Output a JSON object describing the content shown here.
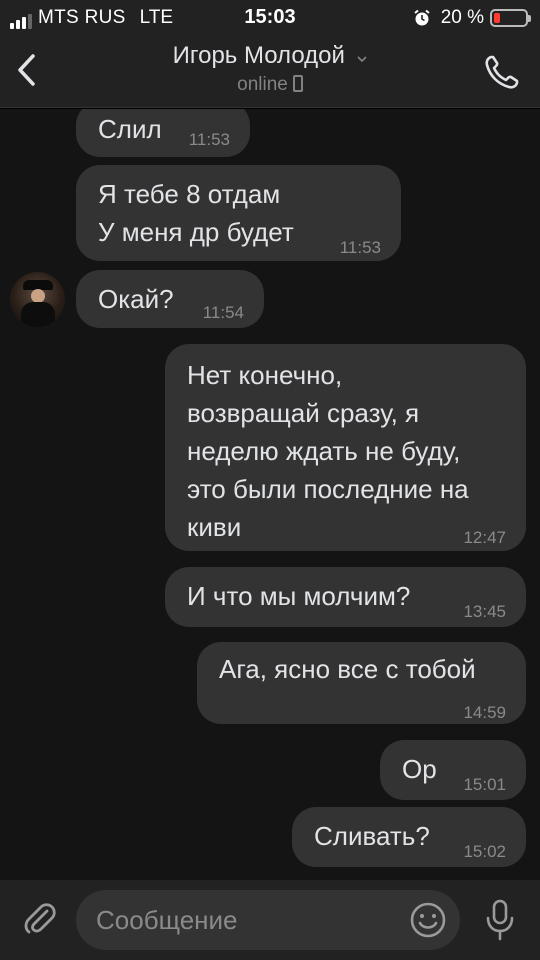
{
  "status_bar": {
    "carrier": "MTS RUS",
    "network": "LTE",
    "time": "15:03",
    "battery": "20 %",
    "battery_level": 0.2
  },
  "header": {
    "title": "Игорь Молодой",
    "status": "online"
  },
  "messages": [
    {
      "direction": "in",
      "text": "Слил",
      "time": "11:53"
    },
    {
      "direction": "in",
      "text": "Я тебе 8 отдам\nУ меня др будет",
      "time": "11:53"
    },
    {
      "direction": "in",
      "text": "Окай?",
      "time": "11:54"
    },
    {
      "direction": "out",
      "text": "Нет конечно,\nвозвращай сразу, я\nнеделю ждать не буду,\nэто были последние на\nкиви",
      "time": "12:47"
    },
    {
      "direction": "out",
      "text": "И что мы молчим?",
      "time": "13:45"
    },
    {
      "direction": "out",
      "text": "Ага, ясно все с тобой",
      "time": "14:59"
    },
    {
      "direction": "out",
      "text": "Ор",
      "time": "15:01"
    },
    {
      "direction": "out",
      "text": "Сливать?",
      "time": "15:02"
    }
  ],
  "composer": {
    "placeholder": "Сообщение"
  },
  "colors": {
    "bubble": "#333333",
    "background": "#141414",
    "bar": "#222222",
    "accent": "#e1e3e6",
    "battery_low": "#ff3b30"
  },
  "icons": {
    "back": "chevron-left-icon",
    "call": "phone-call-icon",
    "attach": "paperclip-icon",
    "emoji": "smile-icon",
    "mic": "microphone-icon",
    "alarm": "alarm-clock-icon"
  }
}
